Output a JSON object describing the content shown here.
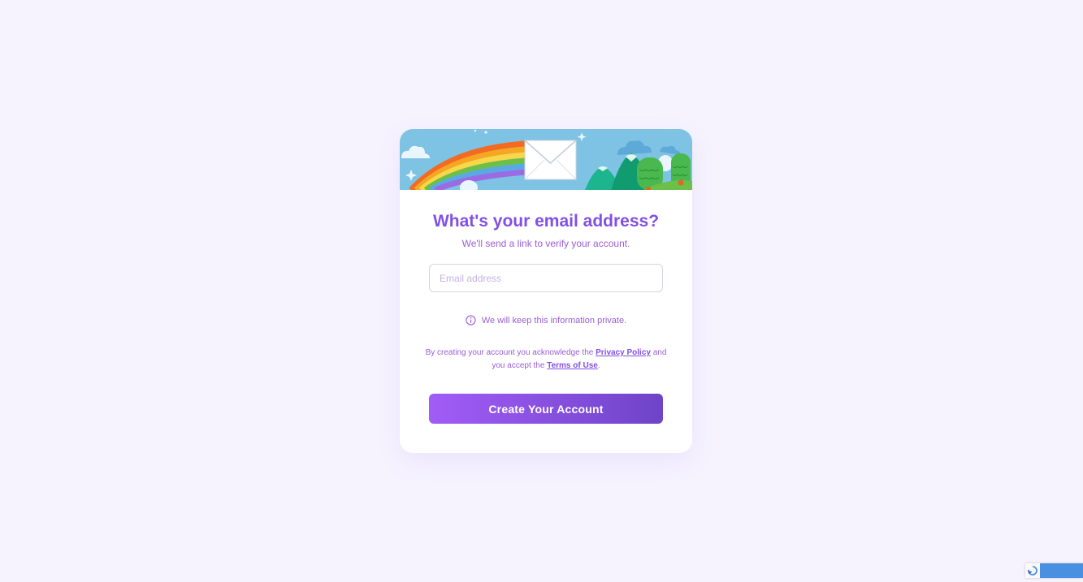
{
  "signup": {
    "banner": {
      "image_name": "rainbow-envelope-landscape-illustration",
      "colors": {
        "sky": "#7ec3e4",
        "hills": "#1db58e",
        "trees": "#49b84e"
      }
    },
    "title": "What's your email address?",
    "subtitle": "We'll send a link to verify your account.",
    "email_input": {
      "placeholder": "Email address",
      "value": ""
    },
    "privacy_note": {
      "icon": "info-icon",
      "text": "We will keep this information private."
    },
    "legal": {
      "prefix": "By creating your account you acknowledge the",
      "privacy_link": "Privacy Policy",
      "middle": "and you accept the",
      "terms_link": "Terms of Use",
      "suffix": "."
    },
    "cta_label": "Create Your Account"
  },
  "recaptcha_badge": {
    "icon": "recaptcha-icon"
  },
  "colors": {
    "page_background": "#f6f3ff",
    "accent": "#8250e6",
    "button_gradient_start": "#a25cf7",
    "button_gradient_end": "#6f44c8"
  }
}
